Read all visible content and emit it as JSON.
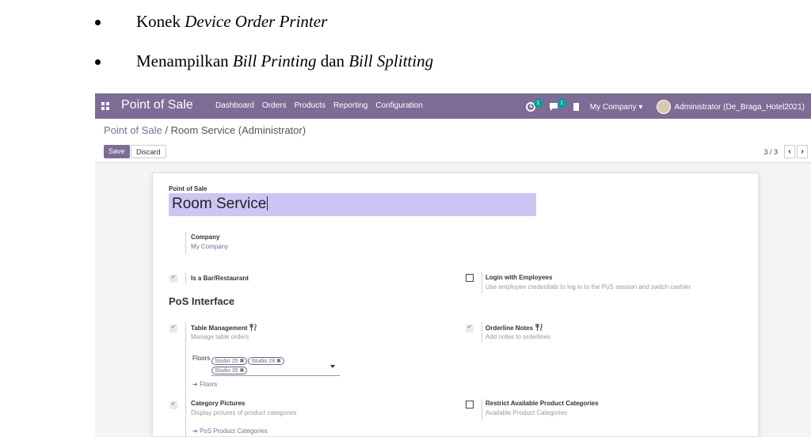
{
  "document": {
    "bullets": [
      {
        "prefix": "Konek ",
        "italic1": "Device Order Printer",
        "middle": "",
        "italic2": ""
      },
      {
        "prefix": "Menampilkan ",
        "italic1": "Bill Printing",
        "middle": " dan ",
        "italic2": "Bill Splitting"
      }
    ]
  },
  "navbar": {
    "app_name": "Point of Sale",
    "menu": [
      "Dashboard",
      "Orders",
      "Products",
      "Reporting",
      "Configuration"
    ],
    "activity_count": "1",
    "messages_count": "1",
    "company": "My Company",
    "user": "Administrator (De_Braga_Hotel2021)"
  },
  "control_panel": {
    "breadcrumb_root": "Point of Sale",
    "breadcrumb_sep": " / ",
    "breadcrumb_current": "Room Service (Administrator)",
    "save_label": "Save",
    "discard_label": "Discard",
    "pager_value": "3 / 3"
  },
  "form": {
    "name_label": "Point of Sale",
    "name_value": "Room Service",
    "company_label": "Company",
    "company_value": "My Company",
    "is_bar": {
      "title": "Is a Bar/Restaurant",
      "checked": true
    },
    "login_employees": {
      "title": "Login with Employees",
      "desc": "Use employee credentials to log in to the PoS session and switch cashier",
      "checked": false
    },
    "section_title": "PoS Interface",
    "table_management": {
      "title": "Table Management",
      "desc": "Manage table orders",
      "checked": true
    },
    "orderline_notes": {
      "title": "Orderline Notes",
      "desc": "Add notes to orderlines",
      "checked": true
    },
    "floors_label": "Floors",
    "floors": [
      "Studio 25",
      "Studio 28",
      "Studio 35"
    ],
    "floors_link": "Floors",
    "category_pictures": {
      "title": "Category Pictures",
      "desc": "Display pictures of product categories",
      "checked": true
    },
    "restrict_categories": {
      "title": "Restrict Available Product Categories",
      "desc": "Available Product Categories",
      "checked": false
    },
    "pos_categories_link": "PoS Product Categories"
  }
}
